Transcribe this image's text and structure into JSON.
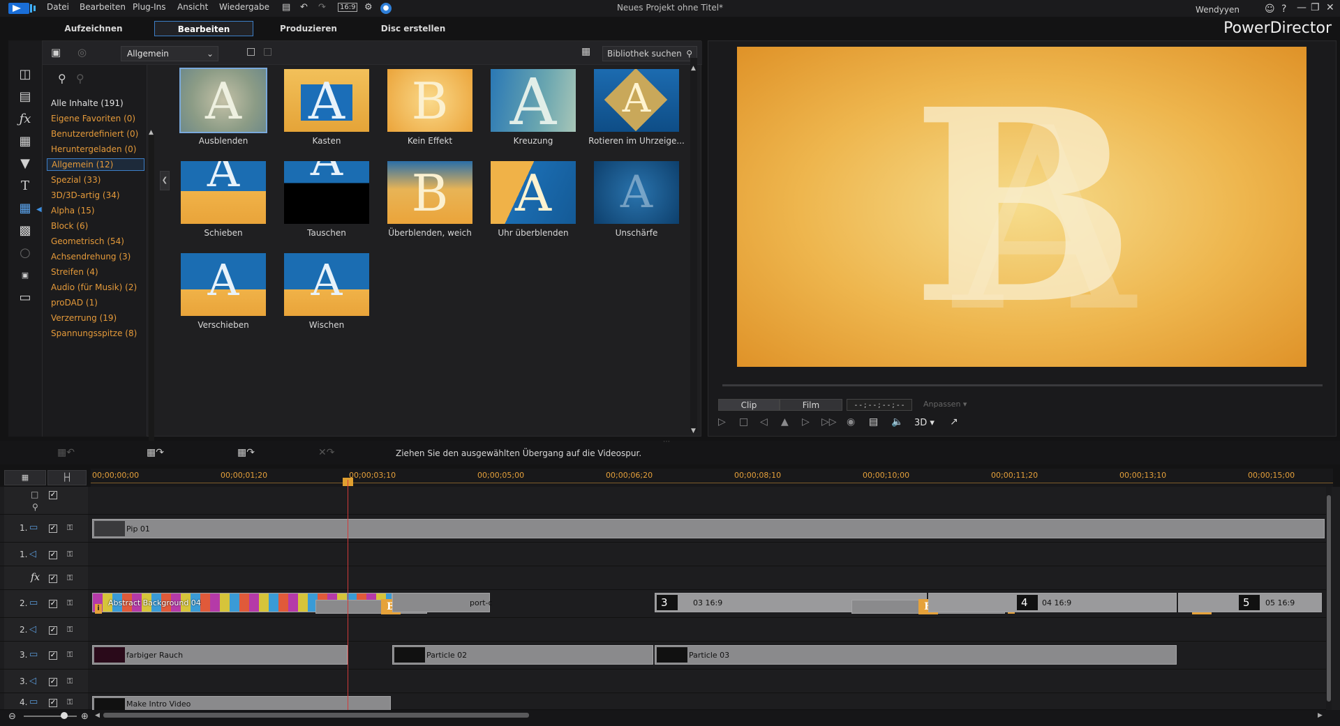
{
  "menu": {
    "items": [
      "Datei",
      "Bearbeiten",
      "Plug-Ins",
      "Ansicht",
      "Wiedergabe"
    ],
    "aspect": "16:9"
  },
  "window": {
    "title": "Neues Projekt ohne Titel*",
    "user": "Wendyyen",
    "help": "?",
    "brand": "PowerDirector"
  },
  "modes": [
    "Aufzeichnen",
    "Bearbeiten",
    "Produzieren",
    "Disc erstellen"
  ],
  "library": {
    "dropdown": "Allgemein",
    "search_placeholder": "Bibliothek suchen",
    "categories": [
      "Alle Inhalte  (191)",
      "Eigene Favoriten  (0)",
      "Benutzerdefiniert  (0)",
      "Heruntergeladen  (0)",
      "Allgemein  (12)",
      "Spezial  (33)",
      "3D/3D-artig  (34)",
      "Alpha  (15)",
      "Block  (6)",
      "Geometrisch  (54)",
      "Achsendrehung  (3)",
      "Streifen  (4)",
      "Audio (für Musik)  (2)",
      "proDAD  (1)",
      "Verzerrung  (19)",
      "Spannungsspitze  (8)"
    ],
    "transitions": [
      "Ausblenden",
      "Kasten",
      "Kein Effekt",
      "Kreuzung",
      "Rotieren im Uhrzeige...",
      "Schieben",
      "Tauschen",
      "Überblenden, weich",
      "Uhr überblenden",
      "Unschärfe",
      "Verschieben",
      "Wischen"
    ],
    "letters": [
      "A",
      "A",
      "B",
      "A",
      "A",
      "A",
      "A",
      "B",
      "A",
      "A",
      "A",
      "A"
    ]
  },
  "preview": {
    "tabs": [
      "Clip",
      "Film"
    ],
    "timecode": "- - ; - - ; - - ; - -",
    "fit": "Anpassen",
    "mode3d": "3D",
    "letter_b": "B",
    "letter_a": "A"
  },
  "timeline": {
    "hint": "Ziehen Sie den ausgewählten Übergang auf die Videospur.",
    "ruler": [
      "00;00;00;00",
      "00;00;01;20",
      "00;00;03;10",
      "00;00;05;00",
      "00;00;06;20",
      "00;00;08;10",
      "00;00;10;00",
      "00;00;11;20",
      "00;00;13;10",
      "00;00;15;00"
    ],
    "track_labels": [
      "1.",
      "1.",
      "2.",
      "2.",
      "3.",
      "3.",
      "4."
    ],
    "fx_label": "fx",
    "clips": {
      "pip": "Pip 01",
      "abstract": "Abstract Background 04",
      "port": "port-c",
      "c3_num": "3",
      "c3_lab": "03 16:9",
      "c4_num": "4",
      "c4_lab": "04 16:9",
      "c5_num": "5",
      "c5_lab": "05 16:9",
      "rauch": "farbiger Rauch",
      "p02": "Particle 02",
      "p03": "Particle 03",
      "intro": "Make Intro Video",
      "b_badge": "B",
      "i_badge": "i"
    }
  },
  "colors": {
    "accent_blue": "#3d7fc8",
    "category_orange": "#e59a3a",
    "playhead": "#d23a3a"
  }
}
